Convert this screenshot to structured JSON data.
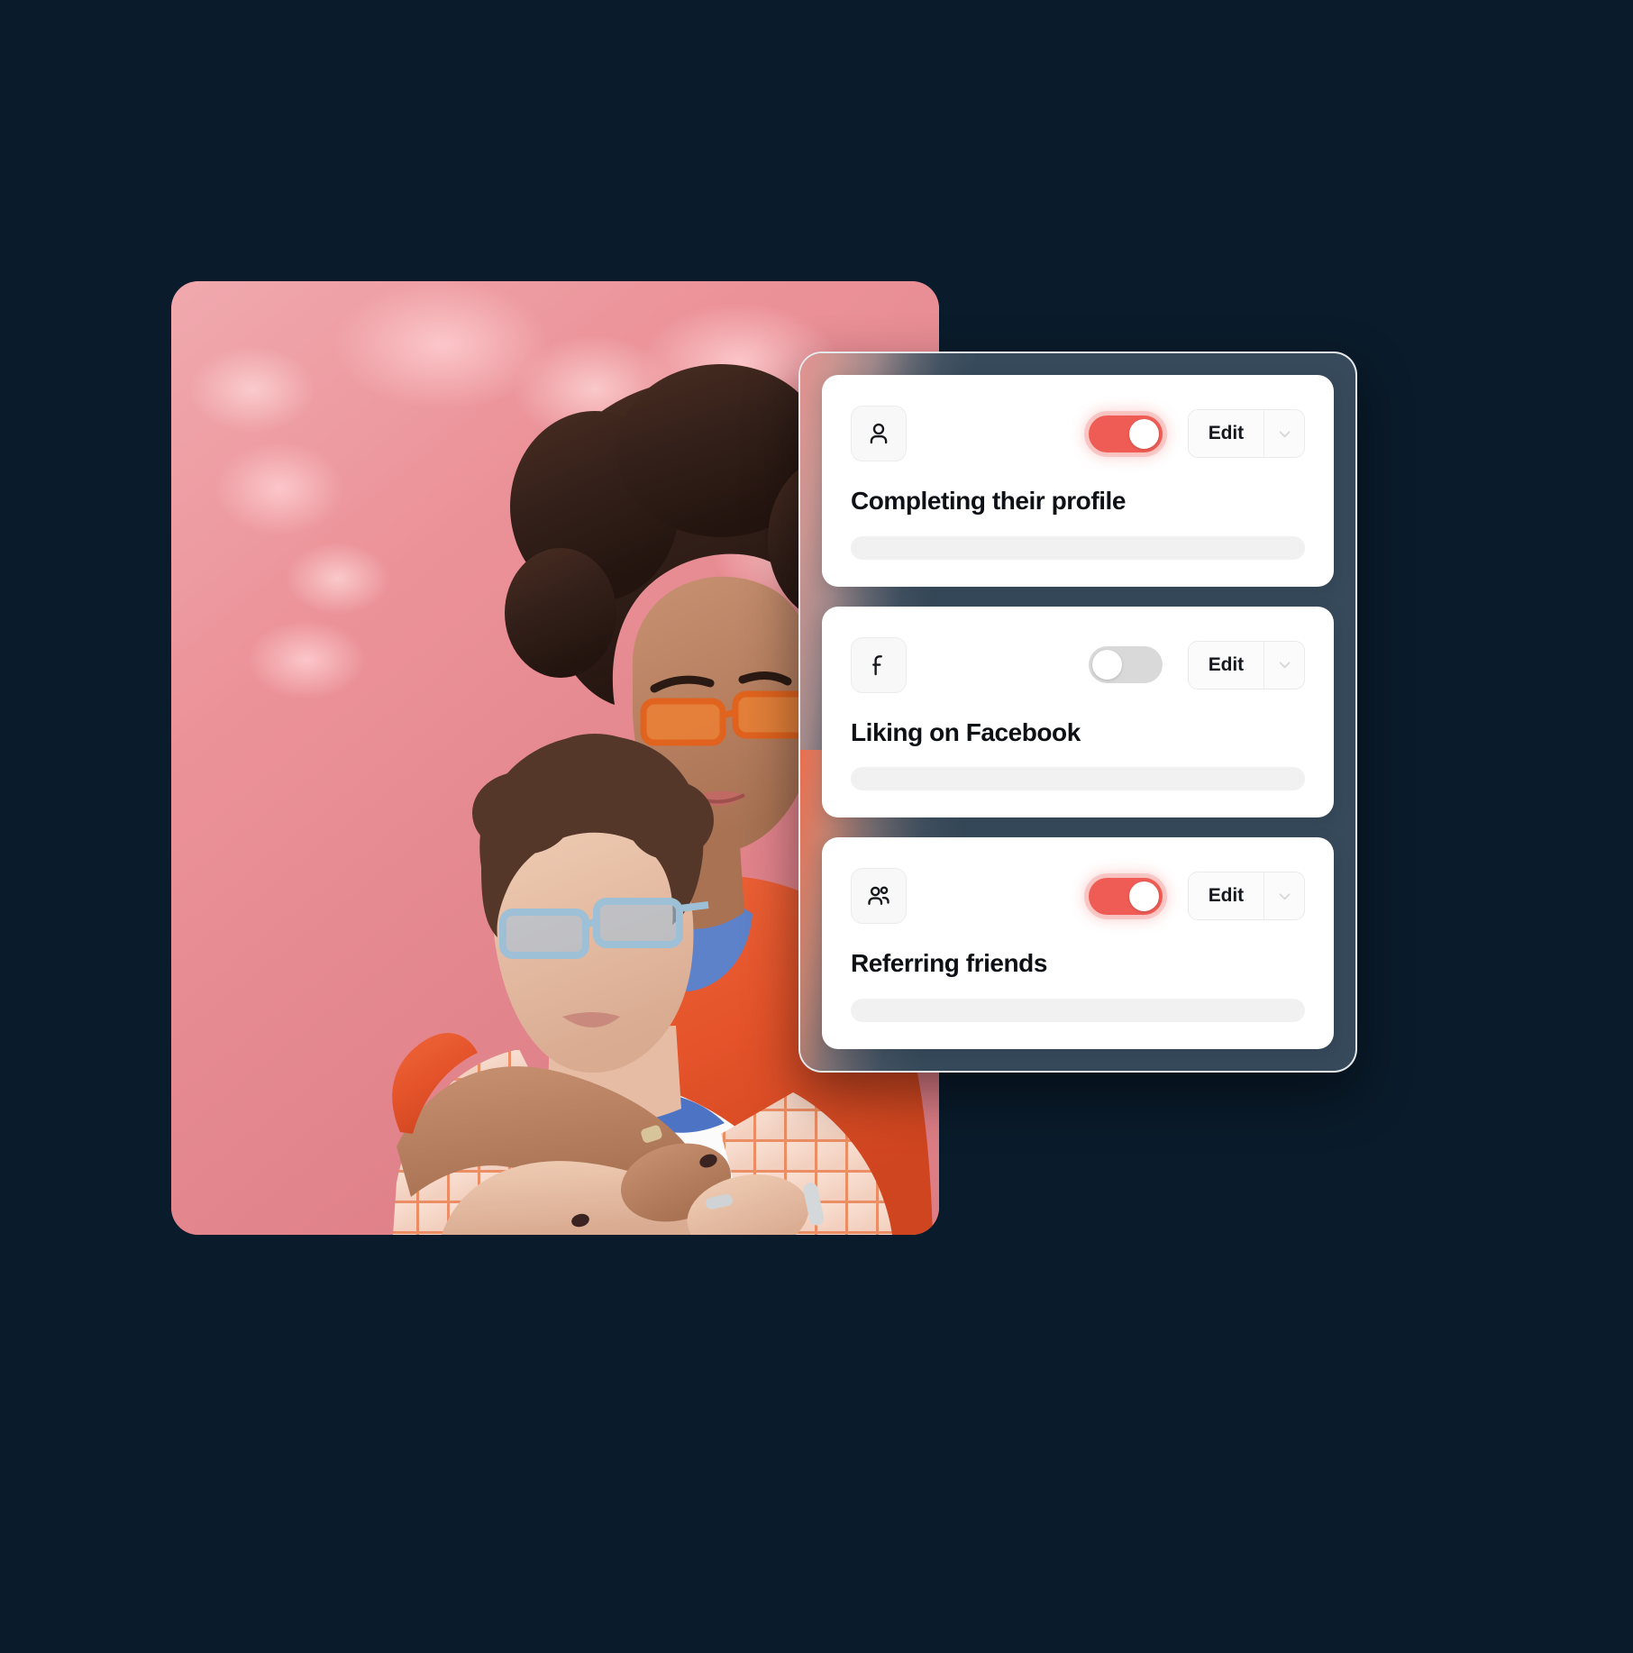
{
  "theme": {
    "background": "#0a1b2b",
    "panel_bg": "#374a5b",
    "panel_border": "#ffffff",
    "accent_on": "#ef5c55",
    "toggle_off": "#d9d9da",
    "card_bg": "#ffffff",
    "skeleton": "#f1f1f2",
    "title_color": "#0d1116"
  },
  "photo": {
    "alt": "Two young people posing together against a pink backdrop with dappled light; the person behind has a large afro and orange rectangular sunglasses and an orange denim jacket, the person in front wears pale blue rectangular sunglasses, an orange checked shirt and a white tee",
    "backdrop_color": "#e98a90",
    "accent_clothing_color": "#e9532a"
  },
  "panel": {
    "cards": [
      {
        "icon": "user-icon",
        "toggle": {
          "state": "on",
          "label_on": "on"
        },
        "edit_label": "Edit",
        "chevron": "chevron-down-icon",
        "title": "Completing their profile"
      },
      {
        "icon": "facebook-icon",
        "toggle": {
          "state": "off",
          "label_off": "off"
        },
        "edit_label": "Edit",
        "chevron": "chevron-down-icon",
        "title": "Liking on Facebook"
      },
      {
        "icon": "users-group-icon",
        "toggle": {
          "state": "on",
          "label_on": "on"
        },
        "edit_label": "Edit",
        "chevron": "chevron-down-icon",
        "title": "Referring friends"
      }
    ]
  }
}
